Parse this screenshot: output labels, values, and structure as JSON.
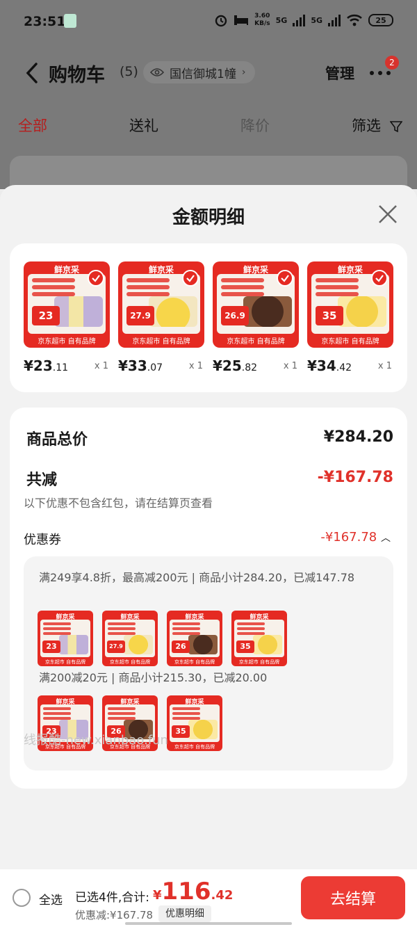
{
  "status_bar": {
    "time": "23:51",
    "speed_top": "3.60",
    "speed_bottom": "KB/s",
    "net1": "5G",
    "net2": "5G",
    "battery": "25"
  },
  "header": {
    "title": "购物车",
    "count": "(5)",
    "address": "国信御城1幢",
    "manage": "管理",
    "badge": "2"
  },
  "tabs": [
    {
      "label": "全部"
    },
    {
      "label": "送礼"
    },
    {
      "label": "降价"
    },
    {
      "label": "筛选"
    }
  ],
  "sheet": {
    "title": "金额明细",
    "products": [
      {
        "brand": "鲜京采",
        "tag": "23",
        "footer": "京东超市 自有品牌",
        "price_int": "¥23",
        "price_dec": ".11",
        "qty": "x 1"
      },
      {
        "brand": "鲜京采",
        "tag": "27.9",
        "footer": "京东超市 自有品牌",
        "price_int": "¥33",
        "price_dec": ".07",
        "qty": "x 1"
      },
      {
        "brand": "鲜京采",
        "tag": "26.9",
        "footer": "京东超市 自有品牌",
        "price_int": "¥25",
        "price_dec": ".82",
        "qty": "x 1"
      },
      {
        "brand": "鲜京采",
        "tag": "35",
        "footer": "京东超市 自有品牌",
        "price_int": "¥34",
        "price_dec": ".42",
        "qty": "x 1"
      }
    ],
    "total_label": "商品总价",
    "total_value": "¥284.20",
    "reduce_label": "共减",
    "reduce_value": "-¥167.78",
    "reduce_note": "以下优惠不包含红包，请在结算页查看",
    "coupon_label": "优惠券",
    "coupon_value": "-¥167.78",
    "coupon1_text": "满249享4.8折，最高减200元 | 商品小计284.20，已减147.78",
    "coupon2_text": "满200减20元 | 商品小计215.30，已减20.00",
    "watermark": "线报酷-new.xianbao.fun"
  },
  "bottom": {
    "select_all": "全选",
    "selected_text": "已选4件,合计:",
    "total_cur": "¥",
    "total_int": "116",
    "total_dec": ".42",
    "discount": "优惠减:¥167.78",
    "detail_button": "优惠明细",
    "checkout": "去结算"
  },
  "colors": {
    "accent": "#e0312a",
    "product_red": "#e52a22"
  }
}
